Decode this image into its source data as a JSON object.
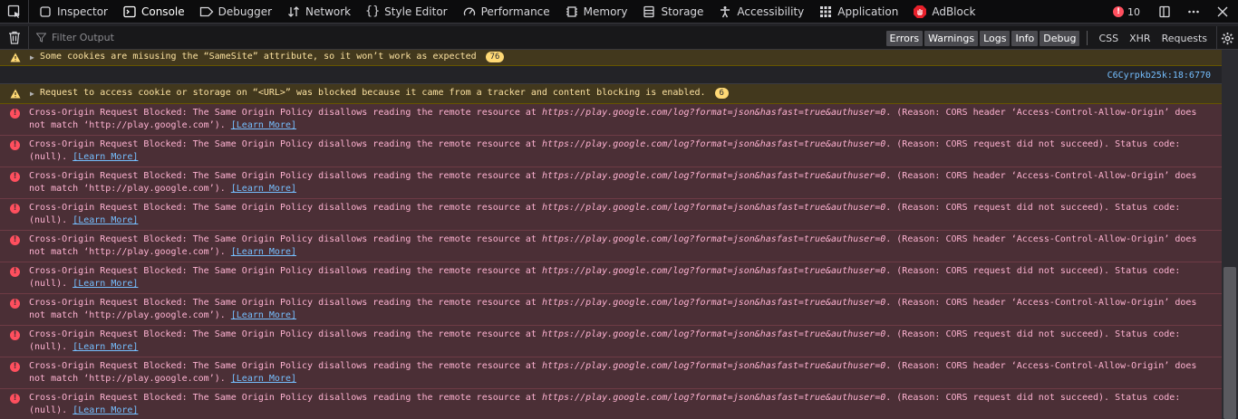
{
  "tabs": [
    {
      "label": "Inspector",
      "icon": "inspector-icon"
    },
    {
      "label": "Console",
      "icon": "console-icon",
      "selected": true
    },
    {
      "label": "Debugger",
      "icon": "debugger-icon"
    },
    {
      "label": "Network",
      "icon": "network-icon"
    },
    {
      "label": "Style Editor",
      "icon": "style-editor-icon"
    },
    {
      "label": "Performance",
      "icon": "performance-icon"
    },
    {
      "label": "Memory",
      "icon": "memory-icon"
    },
    {
      "label": "Storage",
      "icon": "storage-icon"
    },
    {
      "label": "Accessibility",
      "icon": "accessibility-icon"
    },
    {
      "label": "Application",
      "icon": "application-icon"
    },
    {
      "label": "AdBlock",
      "icon": "adblock-icon"
    }
  ],
  "error_count": "10",
  "toolbar": {
    "filter_placeholder": "Filter Output",
    "levels": [
      "Errors",
      "Warnings",
      "Logs",
      "Info",
      "Debug"
    ],
    "types": [
      "CSS",
      "XHR",
      "Requests"
    ]
  },
  "messages": {
    "warning1": {
      "text": "Some cookies are misusing the “SameSite” attribute, so it won’t work as expected",
      "count": "76"
    },
    "location": "C6Cyrpkb25k:18:6770",
    "warning2": {
      "text": "Request to access cookie or storage on “<URL>” was blocked because it came from a tracker and content blocking is enabled.",
      "count": "6"
    },
    "cors_prefix": "Cross-Origin Request Blocked: The Same Origin Policy disallows reading the remote resource at ",
    "cors_url": "https://play.google.com/log?format=json&hasfast=true&authuser=0",
    "reason_header_line1": ". (Reason: CORS header ‘Access-Control-Allow-Origin’ does",
    "reason_header_line2": "not match ‘http://play.google.com’). ",
    "reason_failed_line1": ". (Reason: CORS request did not succeed). Status code:",
    "reason_failed_line2": "(null). ",
    "learn_more": "[Learn More]"
  },
  "colors": {
    "error_bg": "#4b2f36",
    "warning_bg": "#42381d",
    "link": "#75bfff",
    "error_icon": "#ff4f5e"
  }
}
